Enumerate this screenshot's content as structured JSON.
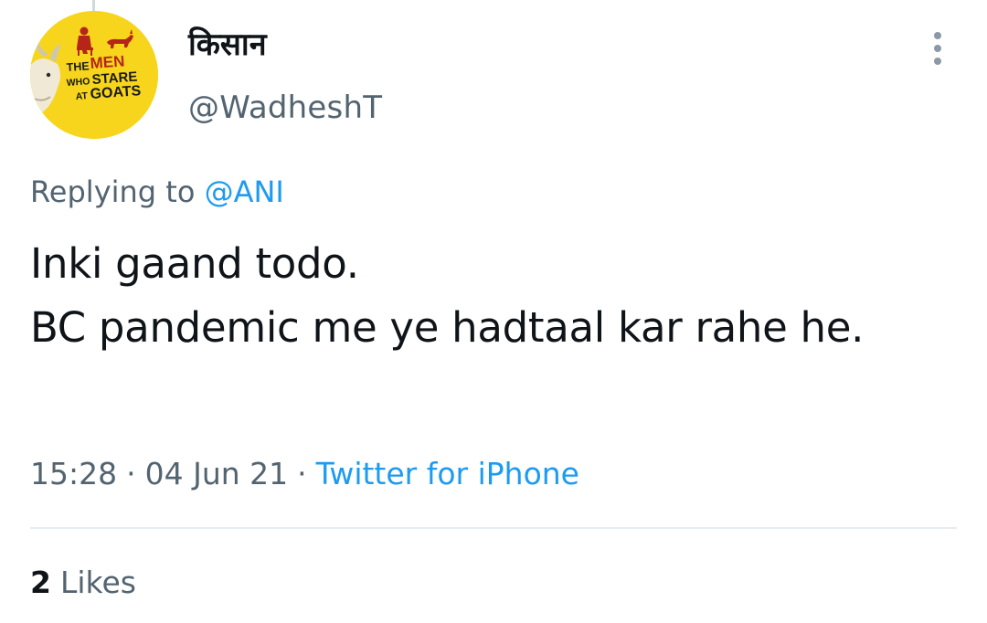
{
  "author": {
    "display_name": "किसान",
    "handle": "@WadheshT",
    "avatar": {
      "icon": "goat-poster-avatar-icon",
      "background": "#f7d51d",
      "logo_lines": [
        "THE MEN",
        "WHO STARE",
        "AT GOATS"
      ]
    }
  },
  "more_icon": "vertical-ellipsis-icon",
  "reply": {
    "prefix": "Replying to",
    "target": "@ANI"
  },
  "tweet": {
    "text": "Inki gaand todo.\nBC pandemic me ye hadtaal kar rahe he."
  },
  "meta": {
    "time": "15:28",
    "date": "04 Jun 21",
    "separator": "·",
    "source": "Twitter for iPhone"
  },
  "engagement": {
    "likes_count": "2",
    "likes_label": "Likes"
  },
  "colors": {
    "link": "#1d9bf0",
    "secondary_text": "#536471",
    "primary_text": "#0f1419",
    "avatar_bg": "#f7d51d"
  }
}
